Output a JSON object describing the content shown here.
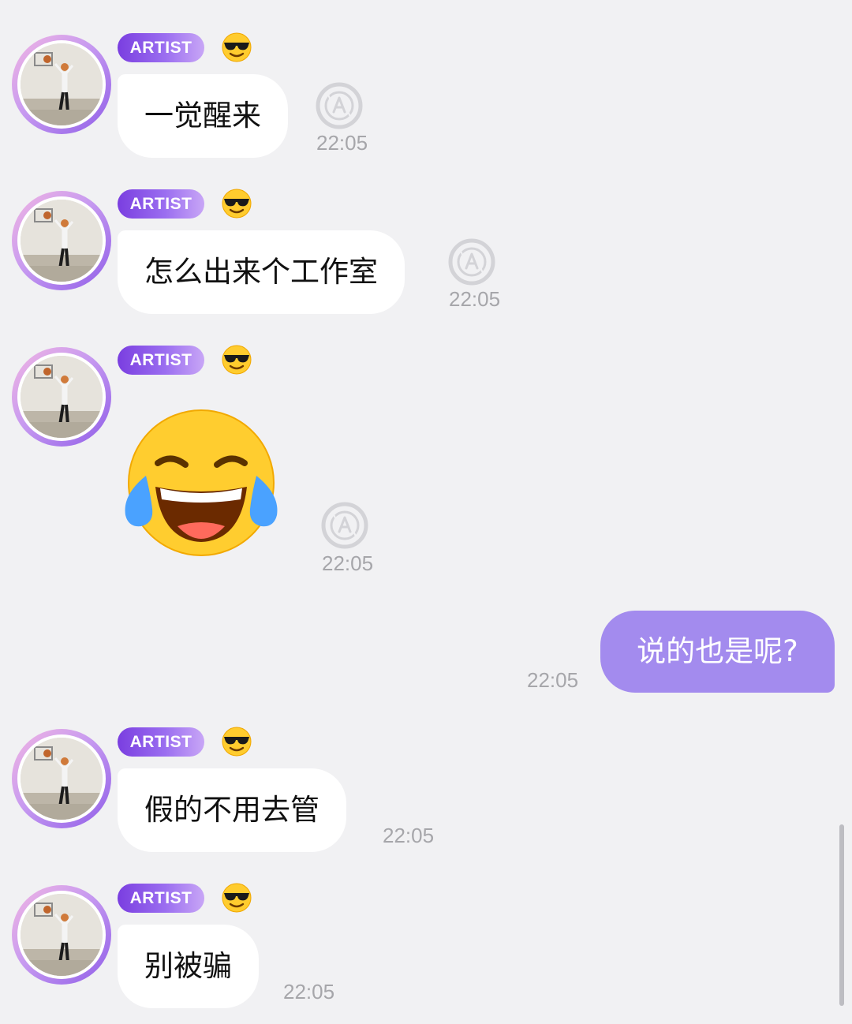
{
  "sender": {
    "badge": "ARTIST",
    "emoji_icon": "smiling-face-with-sunglasses-icon",
    "avatar": "basketball-player-photo"
  },
  "messages": [
    {
      "id": "m1",
      "direction": "incoming",
      "type": "text",
      "text": "一觉醒来",
      "time": "22:05",
      "status_icon": "auto-translate-icon"
    },
    {
      "id": "m2",
      "direction": "incoming",
      "type": "text",
      "text": "怎么出来个工作室",
      "time": "22:05",
      "status_icon": "auto-translate-icon"
    },
    {
      "id": "m3",
      "direction": "incoming",
      "type": "emoji",
      "emoji": "face-with-tears-of-joy-icon",
      "time": "22:05",
      "status_icon": "auto-translate-icon"
    },
    {
      "id": "m4",
      "direction": "outgoing",
      "type": "text",
      "text": "说的也是呢?",
      "time": "22:05"
    },
    {
      "id": "m5",
      "direction": "incoming",
      "type": "text",
      "text": "假的不用去管",
      "time": "22:05"
    },
    {
      "id": "m6",
      "direction": "incoming",
      "type": "text",
      "text": "别被骗",
      "time": "22:05"
    }
  ],
  "colors": {
    "background": "#f1f1f3",
    "incoming_bubble": "#ffffff",
    "outgoing_bubble": "#a38bee",
    "badge_gradient_start": "#7a3ee0",
    "badge_gradient_end": "#c8a6f6",
    "timestamp": "#a6a6aa"
  }
}
